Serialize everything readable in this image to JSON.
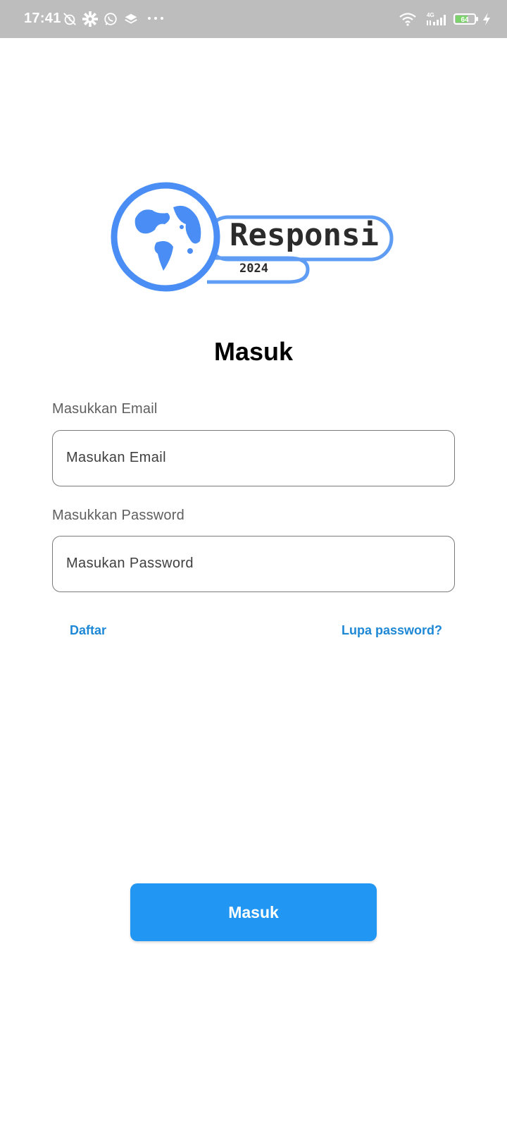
{
  "status_bar": {
    "time": "17:41",
    "network_type": "4G",
    "battery_level": "64",
    "icons": [
      "alarm-off-icon",
      "settings-icon",
      "whatsapp-icon",
      "layers-icon",
      "more-dots-icon",
      "wifi-icon",
      "signal-icon",
      "battery-icon",
      "charging-icon"
    ]
  },
  "logo": {
    "name": "Responsi",
    "year": "2024",
    "accent_color": "#4a8ef5"
  },
  "page": {
    "title": "Masuk"
  },
  "form": {
    "email": {
      "label": "Masukkan Email",
      "placeholder": "Masukan Email",
      "value": ""
    },
    "password": {
      "label": "Masukkan Password",
      "placeholder": "Masukan Password",
      "value": ""
    }
  },
  "links": {
    "register": "Daftar",
    "forgot_password": "Lupa password?"
  },
  "actions": {
    "login_button": "Masuk",
    "button_color": "#2196f3",
    "link_color": "#1e88d6"
  }
}
